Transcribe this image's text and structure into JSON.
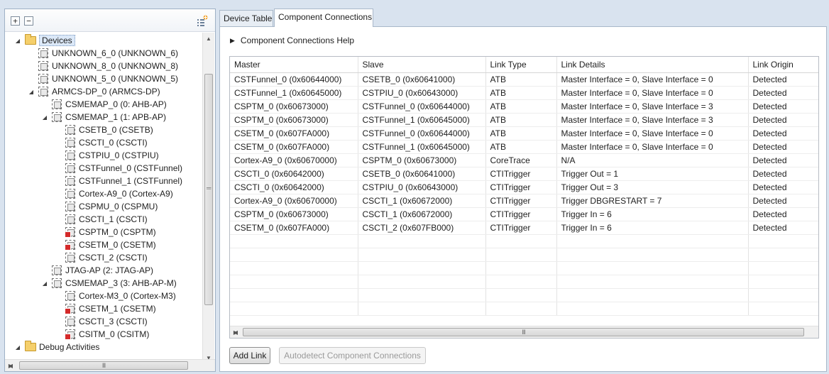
{
  "left": {
    "toolbar": {
      "expand_symbol": "+",
      "collapse_symbol": "−"
    },
    "tree": [
      {
        "label": "Devices",
        "indent": 0,
        "toggle": "open",
        "icon": "folder-icon",
        "selected": true
      },
      {
        "label": "UNKNOWN_6_0 (UNKNOWN_6)",
        "indent": 1,
        "toggle": "none",
        "icon": "chip-icon"
      },
      {
        "label": "UNKNOWN_8_0 (UNKNOWN_8)",
        "indent": 1,
        "toggle": "none",
        "icon": "chip-icon"
      },
      {
        "label": "UNKNOWN_5_0 (UNKNOWN_5)",
        "indent": 1,
        "toggle": "none",
        "icon": "chip-icon"
      },
      {
        "label": "ARMCS-DP_0 (ARMCS-DP)",
        "indent": 1,
        "toggle": "open",
        "icon": "chip-icon"
      },
      {
        "label": "CSMEMAP_0 (0: AHB-AP)",
        "indent": 2,
        "toggle": "none",
        "icon": "chip-icon"
      },
      {
        "label": "CSMEMAP_1 (1: APB-AP)",
        "indent": 2,
        "toggle": "open",
        "icon": "chip-icon"
      },
      {
        "label": "CSETB_0 (CSETB)",
        "indent": 3,
        "toggle": "none",
        "icon": "chip-icon"
      },
      {
        "label": "CSCTI_0 (CSCTI)",
        "indent": 3,
        "toggle": "none",
        "icon": "chip-icon"
      },
      {
        "label": "CSTPIU_0 (CSTPIU)",
        "indent": 3,
        "toggle": "none",
        "icon": "chip-icon"
      },
      {
        "label": "CSTFunnel_0 (CSTFunnel)",
        "indent": 3,
        "toggle": "none",
        "icon": "chip-icon"
      },
      {
        "label": "CSTFunnel_1 (CSTFunnel)",
        "indent": 3,
        "toggle": "none",
        "icon": "chip-icon"
      },
      {
        "label": "Cortex-A9_0 (Cortex-A9)",
        "indent": 3,
        "toggle": "none",
        "icon": "chip-icon"
      },
      {
        "label": "CSPMU_0 (CSPMU)",
        "indent": 3,
        "toggle": "none",
        "icon": "chip-icon"
      },
      {
        "label": "CSCTI_1 (CSCTI)",
        "indent": 3,
        "toggle": "none",
        "icon": "chip-icon"
      },
      {
        "label": "CSPTM_0 (CSPTM)",
        "indent": 3,
        "toggle": "none",
        "icon": "chip-error-icon"
      },
      {
        "label": "CSETM_0 (CSETM)",
        "indent": 3,
        "toggle": "none",
        "icon": "chip-error-icon"
      },
      {
        "label": "CSCTI_2 (CSCTI)",
        "indent": 3,
        "toggle": "none",
        "icon": "chip-icon"
      },
      {
        "label": "JTAG-AP (2: JTAG-AP)",
        "indent": 2,
        "toggle": "none",
        "icon": "chip-icon"
      },
      {
        "label": "CSMEMAP_3 (3: AHB-AP-M)",
        "indent": 2,
        "toggle": "open",
        "icon": "chip-icon"
      },
      {
        "label": "Cortex-M3_0 (Cortex-M3)",
        "indent": 3,
        "toggle": "none",
        "icon": "chip-icon"
      },
      {
        "label": "CSETM_1 (CSETM)",
        "indent": 3,
        "toggle": "none",
        "icon": "chip-error-icon"
      },
      {
        "label": "CSCTI_3 (CSCTI)",
        "indent": 3,
        "toggle": "none",
        "icon": "chip-icon"
      },
      {
        "label": "CSITM_0 (CSITM)",
        "indent": 3,
        "toggle": "none",
        "icon": "chip-error-icon"
      },
      {
        "label": "Debug Activities",
        "indent": 0,
        "toggle": "open",
        "icon": "folder-icon"
      }
    ]
  },
  "tabs": [
    {
      "label": "Device Table",
      "active": false
    },
    {
      "label": "Component Connections",
      "active": true
    }
  ],
  "main": {
    "help_label": "Component Connections Help",
    "columns": [
      "Master",
      "Slave",
      "Link Type",
      "Link Details",
      "Link Origin"
    ],
    "rows": [
      [
        "CSTFunnel_0 (0x60644000)",
        "CSETB_0 (0x60641000)",
        "ATB",
        "Master Interface = 0, Slave Interface = 0",
        "Detected"
      ],
      [
        "CSTFunnel_1 (0x60645000)",
        "CSTPIU_0 (0x60643000)",
        "ATB",
        "Master Interface = 0, Slave Interface = 0",
        "Detected"
      ],
      [
        "CSPTM_0 (0x60673000)",
        "CSTFunnel_0 (0x60644000)",
        "ATB",
        "Master Interface = 0, Slave Interface = 3",
        "Detected"
      ],
      [
        "CSPTM_0 (0x60673000)",
        "CSTFunnel_1 (0x60645000)",
        "ATB",
        "Master Interface = 0, Slave Interface = 3",
        "Detected"
      ],
      [
        "CSETM_0 (0x607FA000)",
        "CSTFunnel_0 (0x60644000)",
        "ATB",
        "Master Interface = 0, Slave Interface = 0",
        "Detected"
      ],
      [
        "CSETM_0 (0x607FA000)",
        "CSTFunnel_1 (0x60645000)",
        "ATB",
        "Master Interface = 0, Slave Interface = 0",
        "Detected"
      ],
      [
        "Cortex-A9_0 (0x60670000)",
        "CSPTM_0 (0x60673000)",
        "CoreTrace",
        "N/A",
        "Detected"
      ],
      [
        "CSCTI_0 (0x60642000)",
        "CSETB_0 (0x60641000)",
        "CTITrigger",
        "Trigger Out = 1",
        "Detected"
      ],
      [
        "CSCTI_0 (0x60642000)",
        "CSTPIU_0 (0x60643000)",
        "CTITrigger",
        "Trigger Out = 3",
        "Detected"
      ],
      [
        "Cortex-A9_0 (0x60670000)",
        "CSCTI_1 (0x60672000)",
        "CTITrigger",
        "Trigger DBGRESTART = 7",
        "Detected"
      ],
      [
        "CSPTM_0 (0x60673000)",
        "CSCTI_1 (0x60672000)",
        "CTITrigger",
        "Trigger In = 6",
        "Detected"
      ],
      [
        "CSETM_0 (0x607FA000)",
        "CSCTI_2 (0x607FB000)",
        "CTITrigger",
        "Trigger In = 6",
        "Detected"
      ]
    ],
    "empty_rows": 6,
    "buttons": {
      "add_link": "Add Link",
      "autodetect": "Autodetect Component Connections"
    }
  }
}
